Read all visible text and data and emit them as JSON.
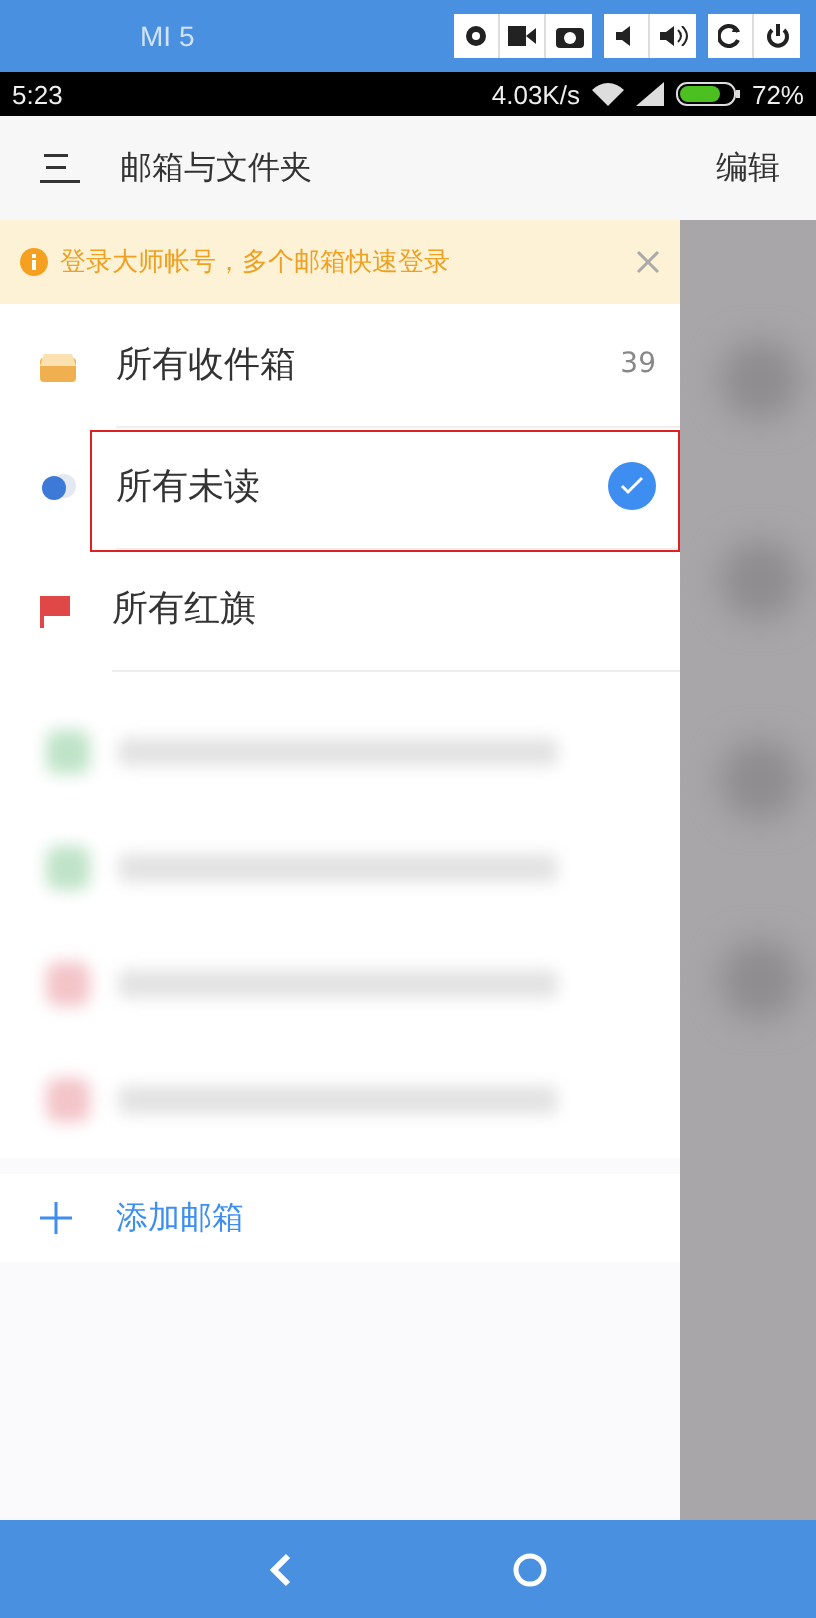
{
  "emulator_toolbar": {
    "device": "MI 5"
  },
  "status_bar": {
    "time": "5:23",
    "speed": "4.03K/s",
    "battery": "72%"
  },
  "header": {
    "title": "邮箱与文件夹",
    "action": "编辑"
  },
  "banner": {
    "text": "登录大师帐号，多个邮箱快速登录"
  },
  "folders": [
    {
      "kind": "inbox",
      "label": "所有收件箱",
      "count": "39",
      "selected": false,
      "highlighted": false
    },
    {
      "kind": "unread",
      "label": "所有未读",
      "selected": true,
      "highlighted": true
    },
    {
      "kind": "flagged",
      "label": "所有红旗",
      "selected": false,
      "highlighted": false
    }
  ],
  "accounts": [
    {
      "color": "#bfe3c8"
    },
    {
      "color": "#bfe3c8"
    },
    {
      "color": "#f3c4c8"
    },
    {
      "color": "#f3c4c8"
    }
  ],
  "add_account": {
    "label": "添加邮箱"
  }
}
